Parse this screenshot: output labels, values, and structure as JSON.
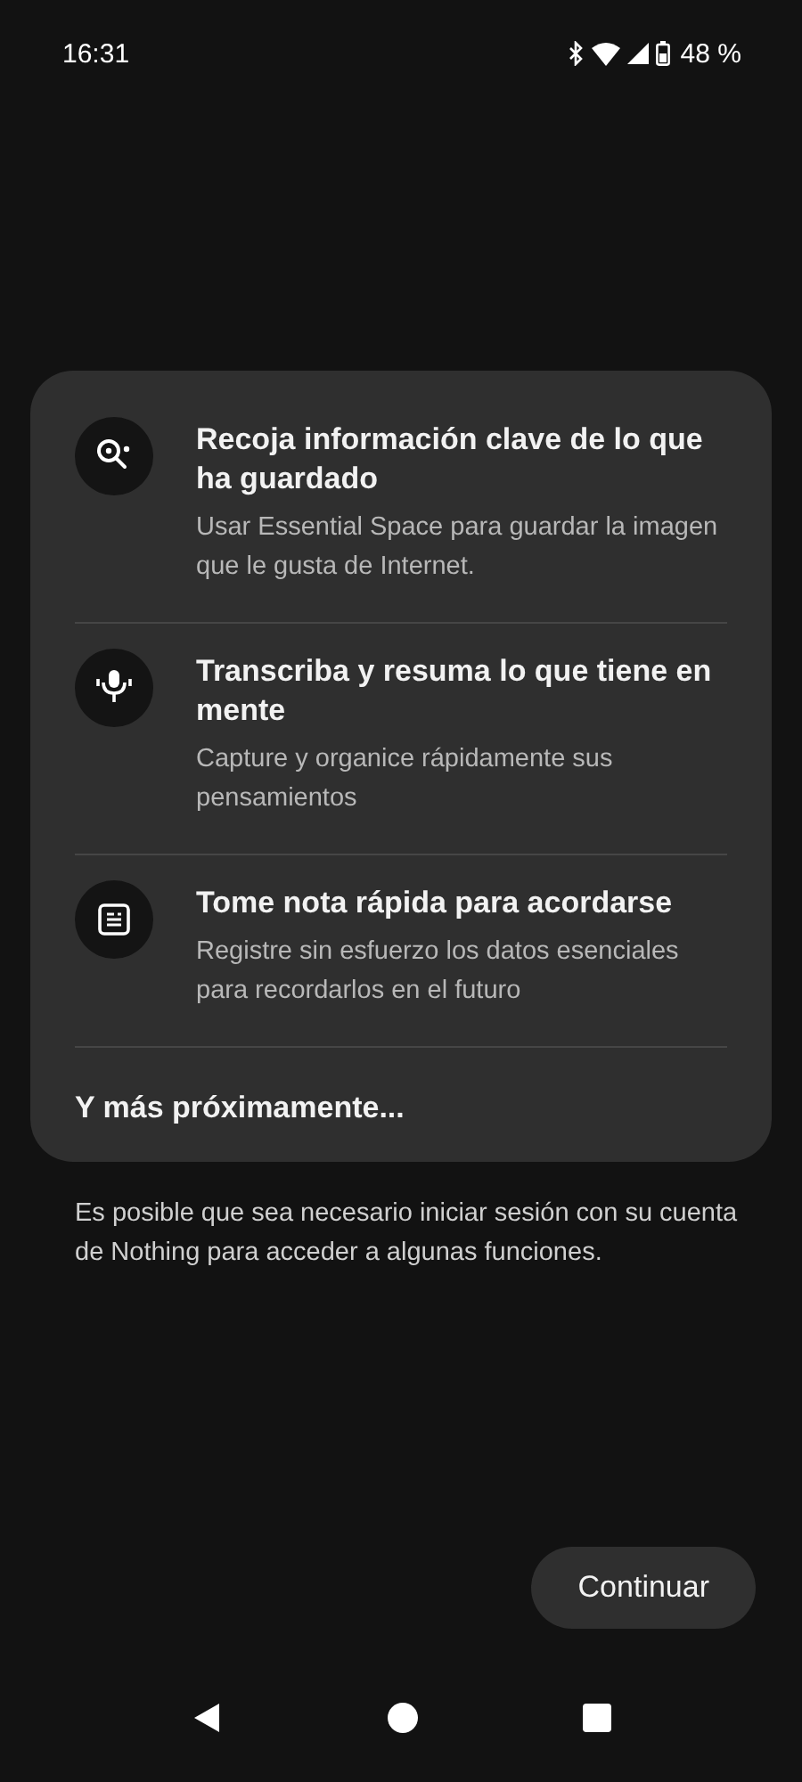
{
  "status_bar": {
    "time": "16:31",
    "battery": "48 %"
  },
  "features": [
    {
      "kind": "search",
      "title": "Recoja información clave de lo que ha guardado",
      "description": "Usar Essential Space para guardar la imagen que le gusta de Internet."
    },
    {
      "kind": "mic",
      "title": "Transcriba y resuma lo que tiene en mente",
      "description": "Capture y organice rápidamente sus pensamientos"
    },
    {
      "kind": "note",
      "title": "Tome nota rápida para acordarse",
      "description": "Registre sin esfuerzo los datos esenciales para recordarlos en el futuro"
    }
  ],
  "more": "Y más próximamente...",
  "notice": "Es posible que sea necesario iniciar sesión con su cuenta de Nothing para acceder a algunas funciones.",
  "continue_button": "Continuar"
}
